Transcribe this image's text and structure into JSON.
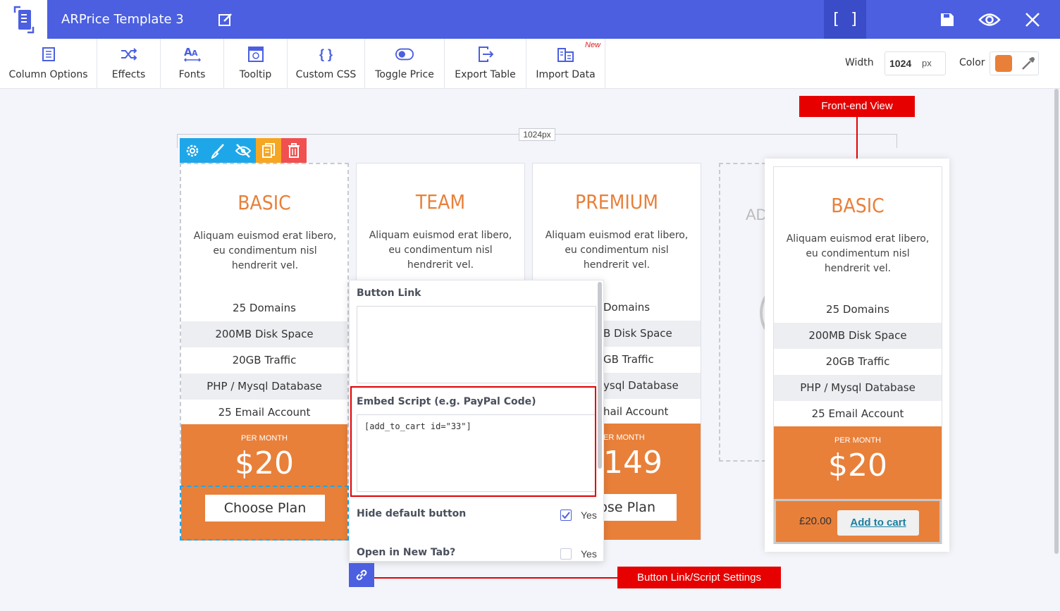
{
  "header": {
    "app_title": "ARPrice Template 3",
    "bracket_label": "[ ]"
  },
  "toolbar": {
    "items": [
      {
        "label": "Column Options",
        "icon": "column-options-icon"
      },
      {
        "label": "Effects",
        "icon": "shuffle-icon"
      },
      {
        "label": "Fonts",
        "icon": "fonts-icon"
      },
      {
        "label": "Tooltip",
        "icon": "tooltip-icon"
      },
      {
        "label": "Custom CSS",
        "icon": "braces-icon"
      },
      {
        "label": "Toggle Price",
        "icon": "toggle-icon"
      },
      {
        "label": "Export Table",
        "icon": "export-icon"
      },
      {
        "label": "Import Data",
        "icon": "import-icon"
      }
    ],
    "new_badge": "New",
    "width_label": "Width",
    "width_value": "1024",
    "width_unit": "px",
    "color_label": "Color",
    "color_value": "#e8803a"
  },
  "canvas": {
    "ruler_label": "1024px",
    "add_column_text": "AD",
    "columns": [
      {
        "name": "BASIC",
        "description": "Aliquam euismod erat libero, eu condimentum nisl hendrerit vel.",
        "features": [
          "25 Domains",
          "200MB Disk Space",
          "20GB Traffic",
          "PHP / Mysql Database",
          "25 Email Account"
        ],
        "per_month": "PER MONTH",
        "price": "$20",
        "button": "Choose Plan"
      },
      {
        "name": "TEAM",
        "description": "Aliquam euismod erat libero, eu condimentum nisl hendrerit vel."
      },
      {
        "name": "PREMIUM",
        "description": "Aliquam euismod erat libero, eu condimentum nisl hendrerit vel.",
        "features": [
          "Domains",
          "B Disk Space",
          "GB Traffic",
          "ysql Database",
          "hail Account"
        ],
        "per_month": "ER MONTH",
        "price": "149",
        "button": "ose Plan"
      }
    ]
  },
  "popup": {
    "button_link_label": "Button Link",
    "button_link_value": "",
    "embed_label": "Embed Script (e.g. PayPal Code)",
    "embed_value": "[add_to_cart id=\"33\"]",
    "hide_default_label": "Hide default button",
    "hide_default_checked": true,
    "hide_default_yes": "Yes",
    "new_tab_label": "Open in New Tab?",
    "new_tab_checked": false,
    "new_tab_yes": "Yes"
  },
  "frontend": {
    "tag": "Front-end View",
    "name": "BASIC",
    "description": "Aliquam euismod erat libero, eu condimentum nisl hendrerit vel.",
    "features": [
      "25 Domains",
      "200MB Disk Space",
      "20GB Traffic",
      "PHP / Mysql Database",
      "25 Email Account"
    ],
    "per_month": "PER MONTH",
    "price": "$20",
    "cart_price": "£20.00",
    "cart_button": "Add to cart"
  },
  "annotations": {
    "button_link_tag": "Button Link/Script Settings"
  },
  "colors": {
    "accent": "#4b5fe0",
    "orange": "#e8803a",
    "annotation_red": "#e60000",
    "tool_blue": "#1ea7e8",
    "tool_yellow": "#f5a623",
    "tool_red": "#f05050"
  }
}
